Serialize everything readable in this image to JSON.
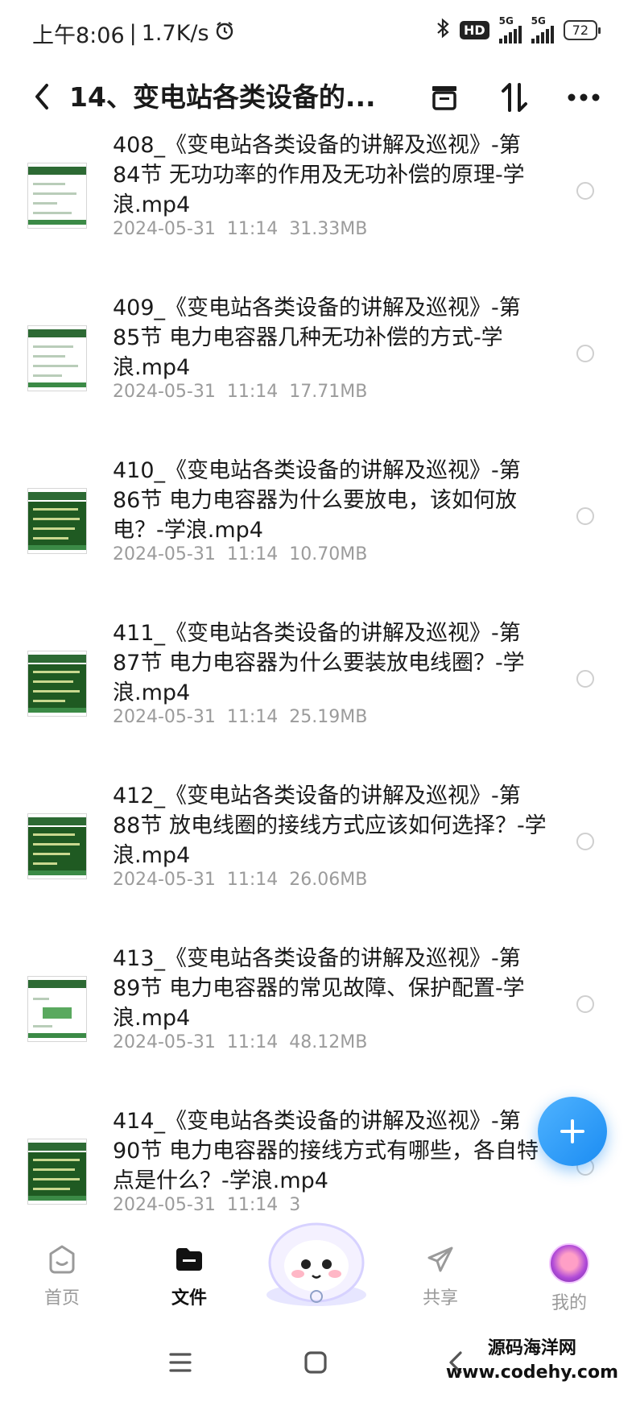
{
  "status_bar": {
    "time": "上午8:06",
    "speed": "1.7K/s",
    "network_badge": "HD",
    "net1": "5G",
    "net2": "5G",
    "battery": "72"
  },
  "header": {
    "title": "14、变电站各类设备的..."
  },
  "files": [
    {
      "name": "408_《变电站各类设备的讲解及巡视》-第84节 无功功率的作用及无功补偿的原理-学浪.mp4",
      "date": "2024-05-31",
      "time": "11:14",
      "size": "31.33MB"
    },
    {
      "name": "409_《变电站各类设备的讲解及巡视》-第85节 电力电容器几种无功补偿的方式-学浪.mp4",
      "date": "2024-05-31",
      "time": "11:14",
      "size": "17.71MB"
    },
    {
      "name": "410_《变电站各类设备的讲解及巡视》-第86节 电力电容器为什么要放电，该如何放电？-学浪.mp4",
      "date": "2024-05-31",
      "time": "11:14",
      "size": "10.70MB"
    },
    {
      "name": "411_《变电站各类设备的讲解及巡视》-第87节 电力电容器为什么要装放电线圈？-学浪.mp4",
      "date": "2024-05-31",
      "time": "11:14",
      "size": "25.19MB"
    },
    {
      "name": "412_《变电站各类设备的讲解及巡视》-第88节 放电线圈的接线方式应该如何选择？-学浪.mp4",
      "date": "2024-05-31",
      "time": "11:14",
      "size": "26.06MB"
    },
    {
      "name": "413_《变电站各类设备的讲解及巡视》-第89节 电力电容器的常见故障、保护配置-学浪.mp4",
      "date": "2024-05-31",
      "time": "11:14",
      "size": "48.12MB"
    },
    {
      "name": "414_《变电站各类设备的讲解及巡视》-第90节 电力电容器的接线方式有哪些，各自特点是什么？-学浪.mp4",
      "date": "2024-05-31",
      "time": "11:14",
      "size": "3"
    }
  ],
  "bottom_nav": {
    "home": "首页",
    "files": "文件",
    "share": "共享",
    "me": "我的"
  },
  "watermark": {
    "line1": "源码海洋网",
    "line2": "www.codehy.com"
  },
  "colors": {
    "accent": "#1b8cf2",
    "thumb_green": "#2d6a34",
    "meta_gray": "#9b9b9b"
  }
}
